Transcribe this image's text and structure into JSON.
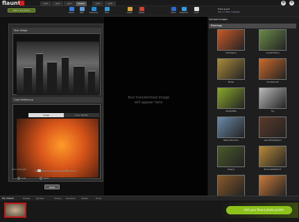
{
  "app": {
    "logo": "flaunt"
  },
  "tabs": [
    "gafil",
    "gafil",
    "gafil",
    "pikasa",
    "gafil",
    "gafil"
  ],
  "topbar_icons": [
    "gear-icon",
    "close-icon"
  ],
  "toolbar": {
    "add_label": "Add a dog photo",
    "tools": [
      {
        "name": "import-tool",
        "label": "Import",
        "color": "#3a7ad9"
      },
      {
        "name": "web-tool",
        "label": "Web",
        "color": "#5aa0e0"
      },
      {
        "name": "download-tool",
        "label": "Download",
        "color": "#2a8ad0"
      },
      {
        "name": "save-tool",
        "label": "Save",
        "color": "#2a9ad8"
      },
      {
        "name": "reset-tool",
        "label": "Reset",
        "color": "#d9a23a"
      },
      {
        "name": "delete-tool",
        "label": "Delete",
        "color": "#d93a2a"
      },
      {
        "name": "share-tool",
        "label": "Share",
        "color": "#2a6ad0"
      },
      {
        "name": "slideshow-tool",
        "label": "Slideshow",
        "color": "#3a9ad9"
      },
      {
        "name": "invite-tool",
        "label": "Invite",
        "color": "#e0e0e0"
      }
    ],
    "hello": "Hello guest",
    "links": "Sign in | Help | Language"
  },
  "left": {
    "your_image": "Your Image",
    "color_reference": "Color Reference",
    "seg_image": "Image",
    "seg_palette": "Color Palette",
    "tone_strength": "Tone Strength",
    "strength_value": "3",
    "radio_soft": "Soft",
    "radio_hard": "Hard",
    "apply": "Apply"
  },
  "canvas": {
    "placeholder": "Your transformed image will appear here"
  },
  "right": {
    "header": "Sample Images",
    "category": "Paintings",
    "thumbs": [
      {
        "label": "FlamingJune",
        "color": "#c85a2a"
      },
      {
        "label": "SunsetChildren",
        "color": "#6a8a4a"
      },
      {
        "label": "Bridge",
        "color": "#a88a3a"
      },
      {
        "label": "CloudySunset",
        "color": "#c86a2a"
      },
      {
        "label": "StarlightNite",
        "color": "#8aa82a"
      },
      {
        "label": "Fog",
        "color": "#bababa"
      },
      {
        "label": "NatholedGardens",
        "color": "#6a8aa8"
      },
      {
        "label": "AgainstTheHighland",
        "color": "#5a3a2a"
      },
      {
        "label": "Allegory",
        "color": "#4a5a2a"
      },
      {
        "label": "BermudaWaterfront",
        "color": "#b88a3a"
      },
      {
        "label": "",
        "color": "#8a5a2a"
      },
      {
        "label": "",
        "color": "#c87a3a"
      }
    ]
  },
  "bottom": {
    "album": "My Album",
    "actions": [
      "Delete",
      "My files",
      "Privacy",
      "Facebook",
      "Twitter",
      "Email"
    ],
    "promo": "Get your flaunt photo prints!"
  }
}
